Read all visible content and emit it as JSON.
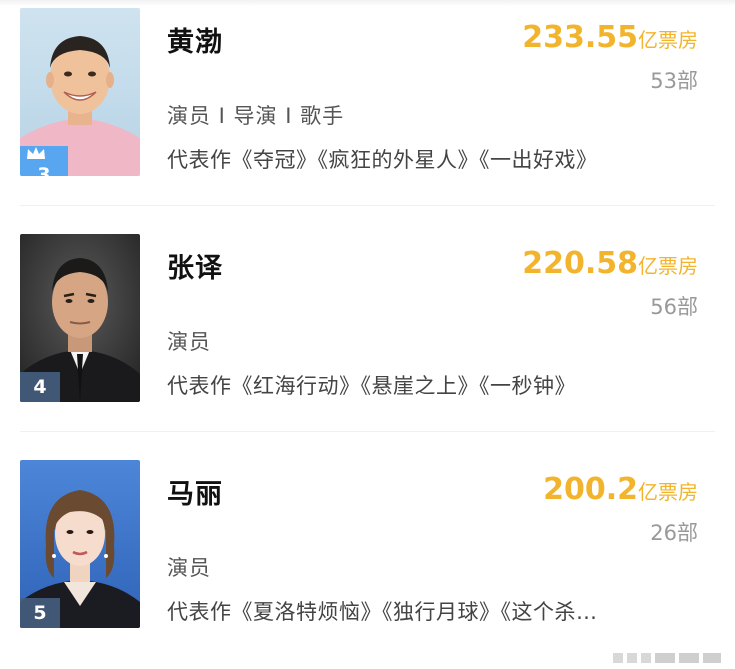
{
  "colors": {
    "boxoffice": "#f2b42c",
    "rank_top": "#58a6f0",
    "rank_default": "#46607f"
  },
  "actors": [
    {
      "name": "黄渤",
      "roles": "演员 I 导演 I 歌手",
      "works": "代表作《夺冠》《疯狂的外星人》《一出好戏》",
      "boxoffice_value": "233.55",
      "boxoffice_unit": "亿票房",
      "film_count": "53部",
      "rank": "3",
      "rank_icon": "crown-icon"
    },
    {
      "name": "张译",
      "roles": "演员",
      "works": "代表作《红海行动》《悬崖之上》《一秒钟》",
      "boxoffice_value": "220.58",
      "boxoffice_unit": "亿票房",
      "film_count": "56部",
      "rank": "4"
    },
    {
      "name": "马丽",
      "roles": "演员",
      "works": "代表作《夏洛特烦恼》《独行月球》《这个杀…",
      "boxoffice_value": "200.2",
      "boxoffice_unit": "亿票房",
      "film_count": "26部",
      "rank": "5"
    }
  ]
}
